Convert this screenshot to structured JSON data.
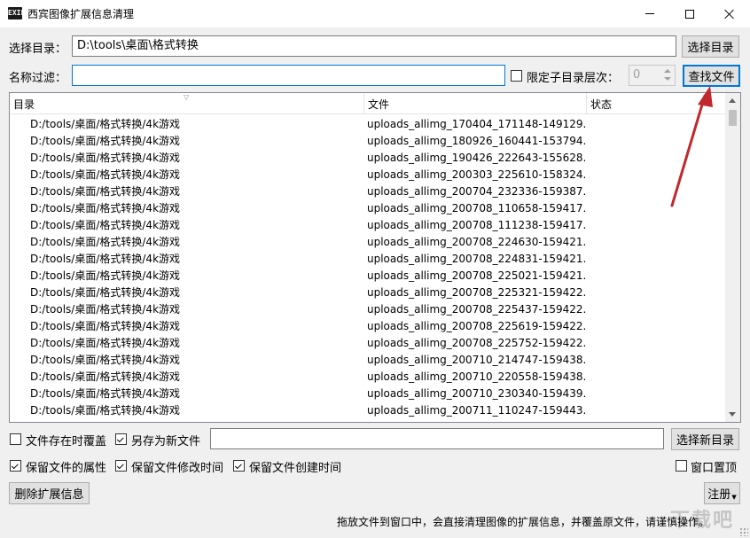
{
  "window": {
    "title": "西宾图像扩展信息清理",
    "icon_text": "EXIF"
  },
  "top_form": {
    "dir_label": "选择目录：",
    "dir_value": "D:\\tools\\桌面\\格式转换",
    "choose_dir_button": "选择目录",
    "filter_label": "名称过滤：",
    "filter_value": "",
    "limit_depth_label": "限定子目录层次：",
    "limit_depth_checked": false,
    "depth_value": "0",
    "find_files_button": "查找文件"
  },
  "list": {
    "columns": [
      "目录",
      "文件",
      "状态"
    ],
    "rows": [
      {
        "dir": "D:/tools/桌面/格式转换/4k游戏",
        "file": "uploads_allimg_170404_171148-149129...",
        "status": ""
      },
      {
        "dir": "D:/tools/桌面/格式转换/4k游戏",
        "file": "uploads_allimg_180926_160441-153794...",
        "status": ""
      },
      {
        "dir": "D:/tools/桌面/格式转换/4k游戏",
        "file": "uploads_allimg_190426_222643-155628...",
        "status": ""
      },
      {
        "dir": "D:/tools/桌面/格式转换/4k游戏",
        "file": "uploads_allimg_200303_225610-158324...",
        "status": ""
      },
      {
        "dir": "D:/tools/桌面/格式转换/4k游戏",
        "file": "uploads_allimg_200704_232336-159387...",
        "status": ""
      },
      {
        "dir": "D:/tools/桌面/格式转换/4k游戏",
        "file": "uploads_allimg_200708_110658-159417...",
        "status": ""
      },
      {
        "dir": "D:/tools/桌面/格式转换/4k游戏",
        "file": "uploads_allimg_200708_111238-159417...",
        "status": ""
      },
      {
        "dir": "D:/tools/桌面/格式转换/4k游戏",
        "file": "uploads_allimg_200708_224630-159421...",
        "status": ""
      },
      {
        "dir": "D:/tools/桌面/格式转换/4k游戏",
        "file": "uploads_allimg_200708_224831-159421...",
        "status": ""
      },
      {
        "dir": "D:/tools/桌面/格式转换/4k游戏",
        "file": "uploads_allimg_200708_225021-159421...",
        "status": ""
      },
      {
        "dir": "D:/tools/桌面/格式转换/4k游戏",
        "file": "uploads_allimg_200708_225321-159422...",
        "status": ""
      },
      {
        "dir": "D:/tools/桌面/格式转换/4k游戏",
        "file": "uploads_allimg_200708_225437-159422...",
        "status": ""
      },
      {
        "dir": "D:/tools/桌面/格式转换/4k游戏",
        "file": "uploads_allimg_200708_225619-159422...",
        "status": ""
      },
      {
        "dir": "D:/tools/桌面/格式转换/4k游戏",
        "file": "uploads_allimg_200708_225752-159422...",
        "status": ""
      },
      {
        "dir": "D:/tools/桌面/格式转换/4k游戏",
        "file": "uploads_allimg_200710_214747-159438...",
        "status": ""
      },
      {
        "dir": "D:/tools/桌面/格式转换/4k游戏",
        "file": "uploads_allimg_200710_220558-159438...",
        "status": ""
      },
      {
        "dir": "D:/tools/桌面/格式转换/4k游戏",
        "file": "uploads_allimg_200710_230340-159439...",
        "status": ""
      },
      {
        "dir": "D:/tools/桌面/格式转换/4k游戏",
        "file": "uploads_allimg_200711_110247-159443...",
        "status": ""
      }
    ]
  },
  "options": {
    "overwrite_label": "文件存在时覆盖",
    "overwrite_checked": false,
    "save_as_new_label": "另存为新文件",
    "save_as_new_checked": true,
    "new_dir_value": "",
    "choose_new_dir_button": "选择新目录",
    "keep_attr_label": "保留文件的属性",
    "keep_attr_checked": true,
    "keep_mtime_label": "保留文件修改时间",
    "keep_mtime_checked": true,
    "keep_ctime_label": "保留文件创建时间",
    "keep_ctime_checked": true,
    "topmost_label": "窗口置顶",
    "topmost_checked": false
  },
  "bottom": {
    "delete_button": "删除扩展信息",
    "register_button": "注册",
    "hint_text": "拖放文件到窗口中，会直接清理图像的扩展信息，并覆盖原文件，请谨慎操作。",
    "watermark": "下载吧"
  },
  "colors": {
    "annotation_arrow": "#c0282d",
    "focus_blue": "#0078d7"
  }
}
